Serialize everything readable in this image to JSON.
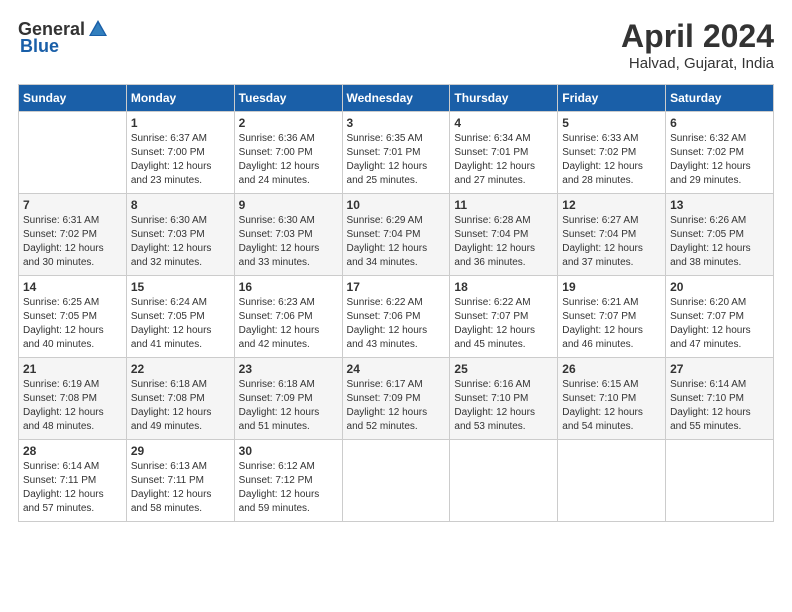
{
  "header": {
    "logo_general": "General",
    "logo_blue": "Blue",
    "month_title": "April 2024",
    "location": "Halvad, Gujarat, India"
  },
  "calendar": {
    "days_of_week": [
      "Sunday",
      "Monday",
      "Tuesday",
      "Wednesday",
      "Thursday",
      "Friday",
      "Saturday"
    ],
    "weeks": [
      [
        {
          "day": "",
          "sunrise": "",
          "sunset": "",
          "daylight": ""
        },
        {
          "day": "1",
          "sunrise": "Sunrise: 6:37 AM",
          "sunset": "Sunset: 7:00 PM",
          "daylight": "Daylight: 12 hours and 23 minutes."
        },
        {
          "day": "2",
          "sunrise": "Sunrise: 6:36 AM",
          "sunset": "Sunset: 7:00 PM",
          "daylight": "Daylight: 12 hours and 24 minutes."
        },
        {
          "day": "3",
          "sunrise": "Sunrise: 6:35 AM",
          "sunset": "Sunset: 7:01 PM",
          "daylight": "Daylight: 12 hours and 25 minutes."
        },
        {
          "day": "4",
          "sunrise": "Sunrise: 6:34 AM",
          "sunset": "Sunset: 7:01 PM",
          "daylight": "Daylight: 12 hours and 27 minutes."
        },
        {
          "day": "5",
          "sunrise": "Sunrise: 6:33 AM",
          "sunset": "Sunset: 7:02 PM",
          "daylight": "Daylight: 12 hours and 28 minutes."
        },
        {
          "day": "6",
          "sunrise": "Sunrise: 6:32 AM",
          "sunset": "Sunset: 7:02 PM",
          "daylight": "Daylight: 12 hours and 29 minutes."
        }
      ],
      [
        {
          "day": "7",
          "sunrise": "Sunrise: 6:31 AM",
          "sunset": "Sunset: 7:02 PM",
          "daylight": "Daylight: 12 hours and 30 minutes."
        },
        {
          "day": "8",
          "sunrise": "Sunrise: 6:30 AM",
          "sunset": "Sunset: 7:03 PM",
          "daylight": "Daylight: 12 hours and 32 minutes."
        },
        {
          "day": "9",
          "sunrise": "Sunrise: 6:30 AM",
          "sunset": "Sunset: 7:03 PM",
          "daylight": "Daylight: 12 hours and 33 minutes."
        },
        {
          "day": "10",
          "sunrise": "Sunrise: 6:29 AM",
          "sunset": "Sunset: 7:04 PM",
          "daylight": "Daylight: 12 hours and 34 minutes."
        },
        {
          "day": "11",
          "sunrise": "Sunrise: 6:28 AM",
          "sunset": "Sunset: 7:04 PM",
          "daylight": "Daylight: 12 hours and 36 minutes."
        },
        {
          "day": "12",
          "sunrise": "Sunrise: 6:27 AM",
          "sunset": "Sunset: 7:04 PM",
          "daylight": "Daylight: 12 hours and 37 minutes."
        },
        {
          "day": "13",
          "sunrise": "Sunrise: 6:26 AM",
          "sunset": "Sunset: 7:05 PM",
          "daylight": "Daylight: 12 hours and 38 minutes."
        }
      ],
      [
        {
          "day": "14",
          "sunrise": "Sunrise: 6:25 AM",
          "sunset": "Sunset: 7:05 PM",
          "daylight": "Daylight: 12 hours and 40 minutes."
        },
        {
          "day": "15",
          "sunrise": "Sunrise: 6:24 AM",
          "sunset": "Sunset: 7:05 PM",
          "daylight": "Daylight: 12 hours and 41 minutes."
        },
        {
          "day": "16",
          "sunrise": "Sunrise: 6:23 AM",
          "sunset": "Sunset: 7:06 PM",
          "daylight": "Daylight: 12 hours and 42 minutes."
        },
        {
          "day": "17",
          "sunrise": "Sunrise: 6:22 AM",
          "sunset": "Sunset: 7:06 PM",
          "daylight": "Daylight: 12 hours and 43 minutes."
        },
        {
          "day": "18",
          "sunrise": "Sunrise: 6:22 AM",
          "sunset": "Sunset: 7:07 PM",
          "daylight": "Daylight: 12 hours and 45 minutes."
        },
        {
          "day": "19",
          "sunrise": "Sunrise: 6:21 AM",
          "sunset": "Sunset: 7:07 PM",
          "daylight": "Daylight: 12 hours and 46 minutes."
        },
        {
          "day": "20",
          "sunrise": "Sunrise: 6:20 AM",
          "sunset": "Sunset: 7:07 PM",
          "daylight": "Daylight: 12 hours and 47 minutes."
        }
      ],
      [
        {
          "day": "21",
          "sunrise": "Sunrise: 6:19 AM",
          "sunset": "Sunset: 7:08 PM",
          "daylight": "Daylight: 12 hours and 48 minutes."
        },
        {
          "day": "22",
          "sunrise": "Sunrise: 6:18 AM",
          "sunset": "Sunset: 7:08 PM",
          "daylight": "Daylight: 12 hours and 49 minutes."
        },
        {
          "day": "23",
          "sunrise": "Sunrise: 6:18 AM",
          "sunset": "Sunset: 7:09 PM",
          "daylight": "Daylight: 12 hours and 51 minutes."
        },
        {
          "day": "24",
          "sunrise": "Sunrise: 6:17 AM",
          "sunset": "Sunset: 7:09 PM",
          "daylight": "Daylight: 12 hours and 52 minutes."
        },
        {
          "day": "25",
          "sunrise": "Sunrise: 6:16 AM",
          "sunset": "Sunset: 7:10 PM",
          "daylight": "Daylight: 12 hours and 53 minutes."
        },
        {
          "day": "26",
          "sunrise": "Sunrise: 6:15 AM",
          "sunset": "Sunset: 7:10 PM",
          "daylight": "Daylight: 12 hours and 54 minutes."
        },
        {
          "day": "27",
          "sunrise": "Sunrise: 6:14 AM",
          "sunset": "Sunset: 7:10 PM",
          "daylight": "Daylight: 12 hours and 55 minutes."
        }
      ],
      [
        {
          "day": "28",
          "sunrise": "Sunrise: 6:14 AM",
          "sunset": "Sunset: 7:11 PM",
          "daylight": "Daylight: 12 hours and 57 minutes."
        },
        {
          "day": "29",
          "sunrise": "Sunrise: 6:13 AM",
          "sunset": "Sunset: 7:11 PM",
          "daylight": "Daylight: 12 hours and 58 minutes."
        },
        {
          "day": "30",
          "sunrise": "Sunrise: 6:12 AM",
          "sunset": "Sunset: 7:12 PM",
          "daylight": "Daylight: 12 hours and 59 minutes."
        },
        {
          "day": "",
          "sunrise": "",
          "sunset": "",
          "daylight": ""
        },
        {
          "day": "",
          "sunrise": "",
          "sunset": "",
          "daylight": ""
        },
        {
          "day": "",
          "sunrise": "",
          "sunset": "",
          "daylight": ""
        },
        {
          "day": "",
          "sunrise": "",
          "sunset": "",
          "daylight": ""
        }
      ]
    ]
  }
}
